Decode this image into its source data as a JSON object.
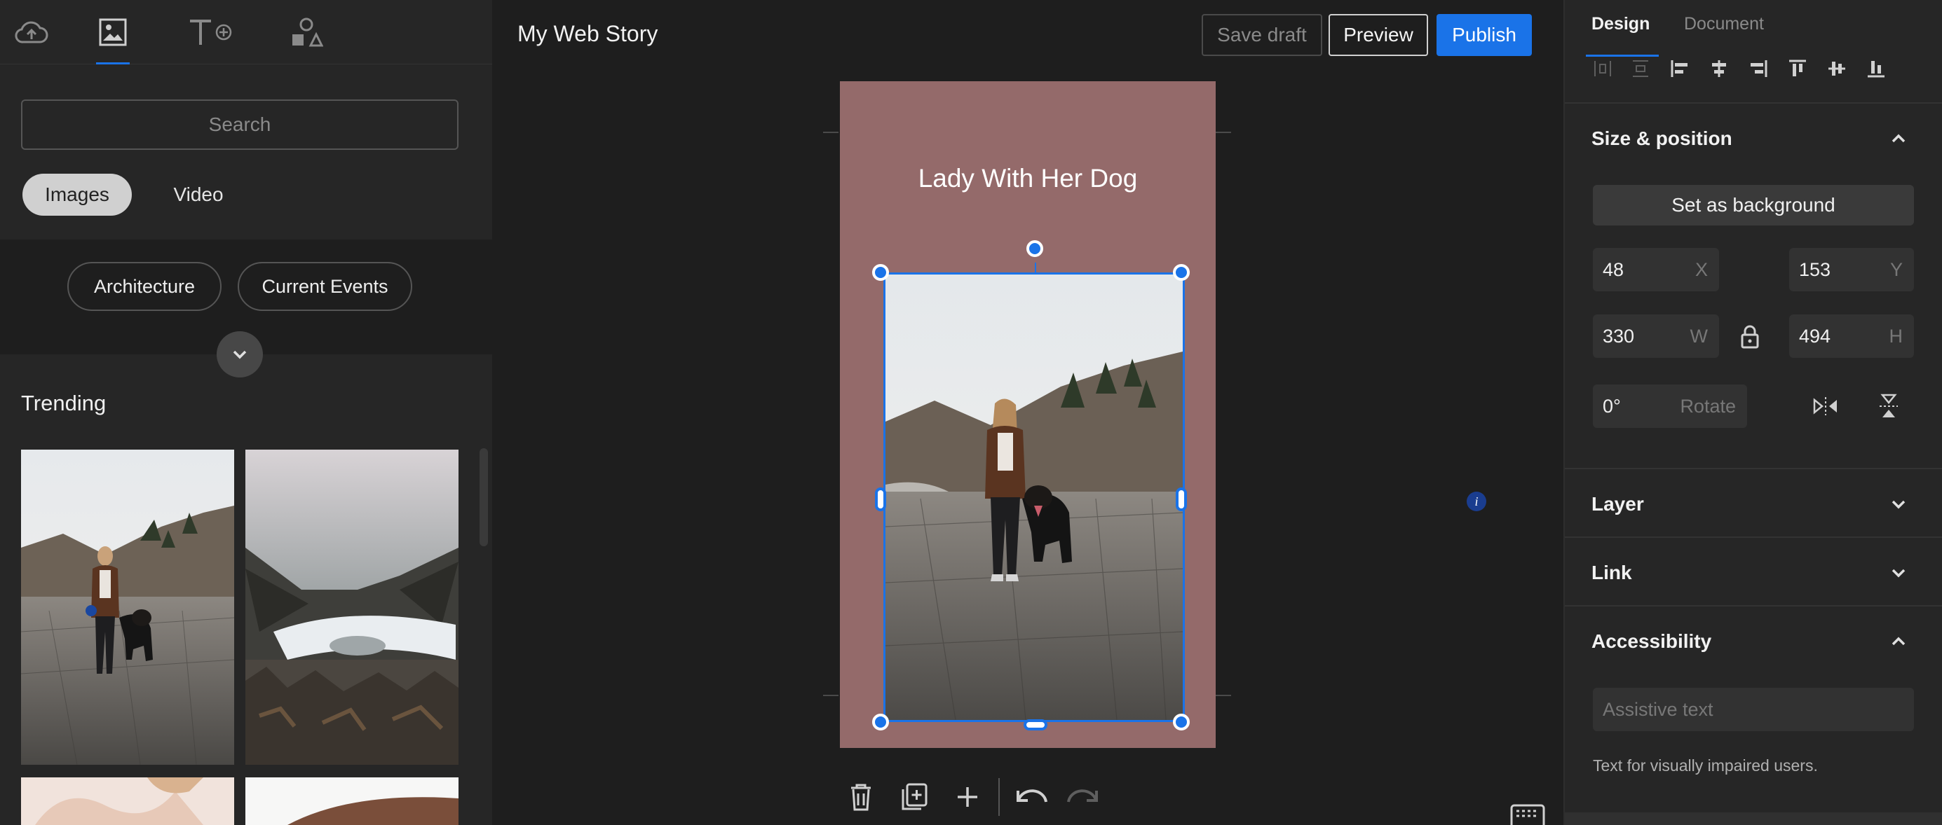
{
  "left_panel": {
    "tabs": [
      "upload-icon",
      "media-icon",
      "text-icon",
      "shapes-icon"
    ],
    "search": {
      "placeholder": "Search",
      "value": ""
    },
    "media_types": {
      "images": "Images",
      "video": "Video"
    },
    "categories": [
      "Architecture",
      "Current Events"
    ],
    "trending_title": "Trending"
  },
  "header": {
    "story_title": "My Web Story",
    "save_draft": "Save draft",
    "preview": "Preview",
    "publish": "Publish"
  },
  "canvas": {
    "page_title": "Lady With Her Dog",
    "page_color": "#946a6a",
    "selection_color": "#1a73e8"
  },
  "bottom_toolbar": [
    "delete-icon",
    "duplicate-icon",
    "add-page-icon",
    "undo-icon",
    "redo-icon"
  ],
  "right_panel": {
    "tabs": {
      "design": "Design",
      "document": "Document"
    },
    "size_position": {
      "title": "Size & position",
      "set_background": "Set as background",
      "x": {
        "value": "48",
        "label": "X"
      },
      "y": {
        "value": "153",
        "label": "Y"
      },
      "w": {
        "value": "330",
        "label": "W"
      },
      "h": {
        "value": "494",
        "label": "H"
      },
      "rotate": {
        "value": "0°",
        "label": "Rotate"
      }
    },
    "layer": "Layer",
    "link": "Link",
    "accessibility": {
      "title": "Accessibility",
      "placeholder": "Assistive text",
      "hint": "Text for visually impaired users."
    }
  }
}
